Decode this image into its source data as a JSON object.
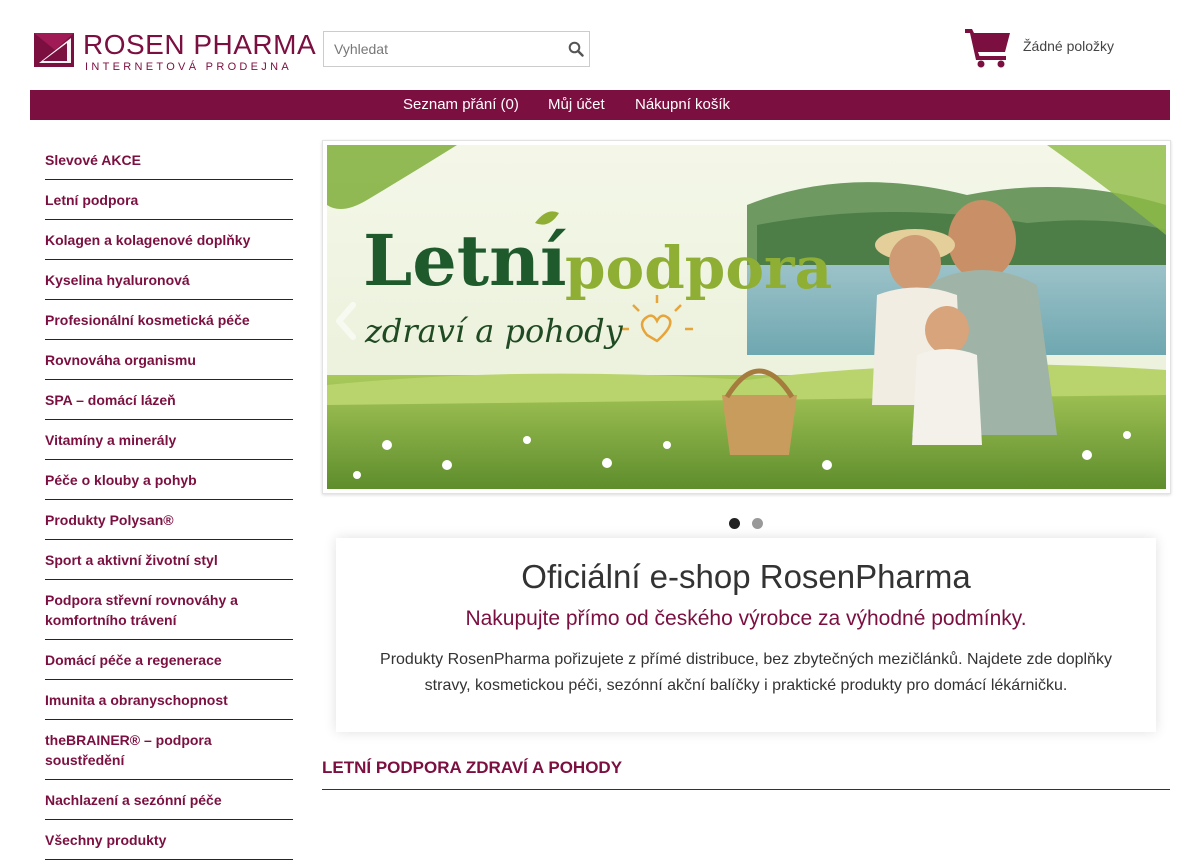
{
  "brand": {
    "name": "ROSEN PHARMA",
    "tagline": "INTERNETOVÁ PRODEJNA",
    "color": "#7b0f40"
  },
  "search": {
    "placeholder": "Vyhledat",
    "icon": "search-icon"
  },
  "cart": {
    "icon": "shopping-cart-icon",
    "status": "Žádné položky"
  },
  "nav": {
    "items": [
      {
        "label": "Seznam přání (0)"
      },
      {
        "label": "Můj účet"
      },
      {
        "label": "Nákupní košík"
      }
    ]
  },
  "sidebar": {
    "items": [
      {
        "label": "Slevové AKCE"
      },
      {
        "label": "Letní podpora"
      },
      {
        "label": "Kolagen a kolagenové doplňky"
      },
      {
        "label": "Kyselina hyaluronová"
      },
      {
        "label": "Profesionální kosmetická péče"
      },
      {
        "label": "Rovnováha organismu"
      },
      {
        "label": "SPA – domácí lázeň"
      },
      {
        "label": "Vitamíny a minerály"
      },
      {
        "label": "Péče o klouby a pohyb"
      },
      {
        "label": "Produkty Polysan®"
      },
      {
        "label": "Sport a aktivní životní styl"
      },
      {
        "label": "Podpora střevní rovnováhy a komfortního trávení"
      },
      {
        "label": "Domácí péče a regenerace"
      },
      {
        "label": "Imunita a obranyschopnost"
      },
      {
        "label": "theBRAINER® – podpora soustředění"
      },
      {
        "label": "Nachlazení a sezónní péče"
      },
      {
        "label": "Všechny produkty"
      }
    ]
  },
  "slider": {
    "banner_line1": "Letní",
    "banner_line2": "podpora",
    "banner_line3": "zdraví a pohody",
    "active_slide": 1,
    "slide_count": 2,
    "dot_active_color": "#222222",
    "dot_inactive_color": "#999999"
  },
  "intro": {
    "title": "Oficiální e-shop RosenPharma",
    "subtitle": "Nakupujte přímo od českého výrobce za výhodné podmínky.",
    "text": "Produkty RosenPharma pořizujete z přímé distribuce, bez zbytečných mezičlánků. Najdete zde doplňky stravy, kosmetickou péči, sezónní akční balíčky i praktické produkty pro domácí lékárničku."
  },
  "section": {
    "title": "LETNÍ PODPORA ZDRAVÍ A POHODY"
  }
}
